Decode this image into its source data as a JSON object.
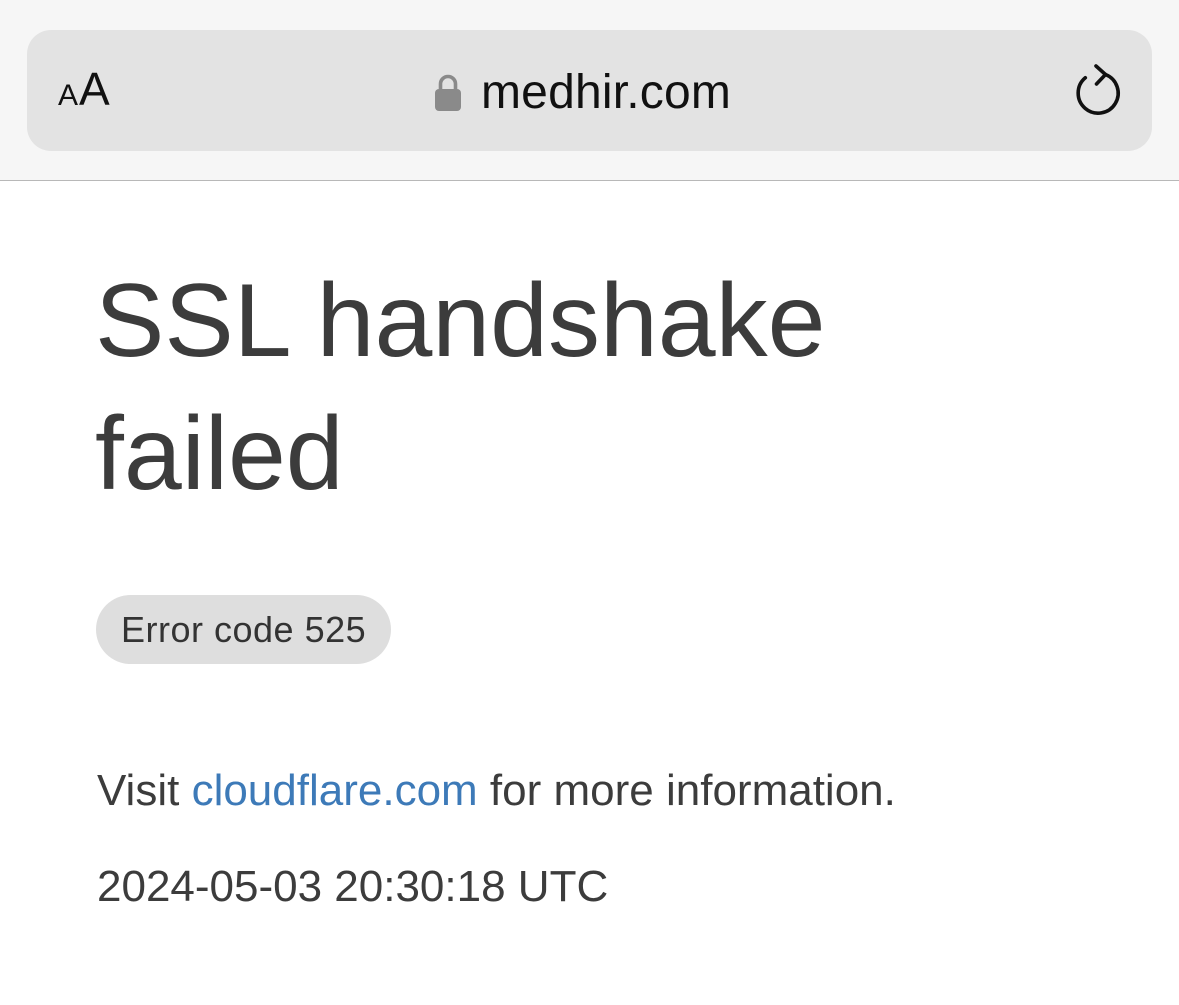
{
  "browser": {
    "text_size_button": {
      "small": "A",
      "large": "A"
    },
    "url": "medhir.com",
    "lock_icon": "lock-icon",
    "reload_icon": "reload-icon"
  },
  "page": {
    "heading": "SSL handshake failed",
    "error_code": "Error code 525",
    "info": {
      "prefix": "Visit ",
      "link": "cloudflare.com",
      "suffix": " for more information."
    },
    "timestamp": "2024-05-03 20:30:18 UTC"
  },
  "colors": {
    "link": "#3d7ab8",
    "text": "#3c3c3c",
    "badge_bg": "#dedede",
    "address_bar_bg": "#e3e3e3"
  }
}
